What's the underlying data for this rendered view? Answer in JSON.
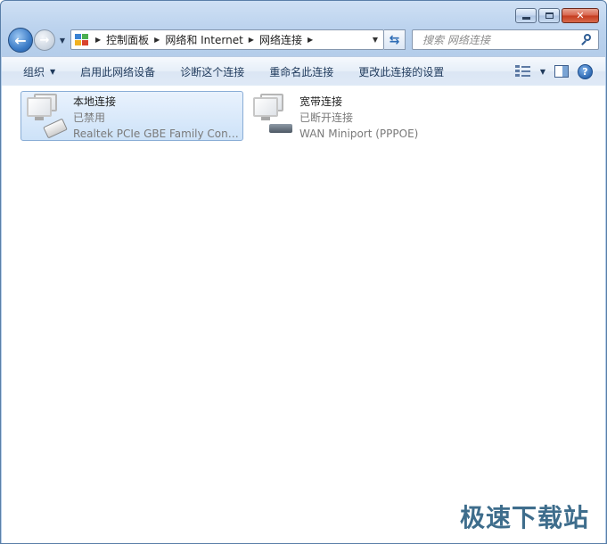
{
  "breadcrumb": {
    "items": [
      "控制面板",
      "网络和 Internet",
      "网络连接"
    ]
  },
  "search": {
    "placeholder": "搜索 网络连接"
  },
  "toolbar": {
    "organize": "组织",
    "enable_device": "启用此网络设备",
    "diagnose": "诊断这个连接",
    "rename": "重命名此连接",
    "change_settings": "更改此连接的设置"
  },
  "connections": [
    {
      "name": "本地连接",
      "status": "已禁用",
      "device": "Realtek PCIe GBE Family Controller",
      "icon": "wired-network-adapter-icon",
      "selected": true
    },
    {
      "name": "宽带连接",
      "status": "已断开连接",
      "device": "WAN Miniport (PPPOE)",
      "icon": "broadband-modem-icon",
      "selected": false
    }
  ],
  "watermark": {
    "text": "极速下载站"
  },
  "colors": {
    "selection_fill": "#cde2f8",
    "selection_border": "#89add6",
    "secondary_text": "#7a7a7a",
    "command_text": "#1e395b"
  }
}
